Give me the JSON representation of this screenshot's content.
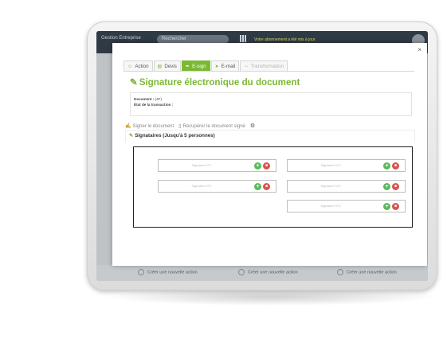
{
  "app": {
    "nav_text": "Gestion Entreprise",
    "search_placeholder": "Rechercher",
    "notice": "Votre abonnement a été mis à jour"
  },
  "background": {
    "bottom_cells": [
      "Créer une nouvelle action",
      "Créer une nouvelle action",
      "Créer une nouvelle action"
    ]
  },
  "modal": {
    "close": "×",
    "tabs": [
      {
        "label": "Action",
        "icon": "user-icon",
        "glyph": "☺"
      },
      {
        "label": "Devis",
        "icon": "document-icon",
        "glyph": "▤"
      },
      {
        "label": "E-sign",
        "icon": "pen-icon",
        "glyph": "✒"
      },
      {
        "label": "E-mail",
        "icon": "send-icon",
        "glyph": "➤"
      },
      {
        "label": "Transformation",
        "icon": "transform-icon",
        "glyph": "⇛"
      }
    ],
    "active_tab": "E-sign",
    "title": "Signature électronique du document",
    "title_glyph": "✎",
    "document_label": "Document :",
    "document_value": "(4F)",
    "state_label": "État de la transaction :",
    "state_value": "",
    "actions": {
      "sign": "Signer le document",
      "retrieve": "Récupérer le document signé"
    },
    "signers_title": "Signataires (Jusqu'à 5 personnes)",
    "signature_placeholder": "Signature N°1",
    "signature_fields": [
      {
        "placeholder": "Signature N°1"
      },
      {
        "placeholder": "Signature N°2"
      },
      {
        "placeholder": "Signature N°3"
      },
      {
        "placeholder": "Signature N°4"
      },
      {
        "placeholder": "Signature N°5"
      }
    ],
    "add_glyph": "+",
    "delete_glyph": "■"
  },
  "colors": {
    "accent": "#7bb935",
    "add": "#5cb85c",
    "delete": "#d9534f",
    "app_header": "#2f3a45"
  }
}
